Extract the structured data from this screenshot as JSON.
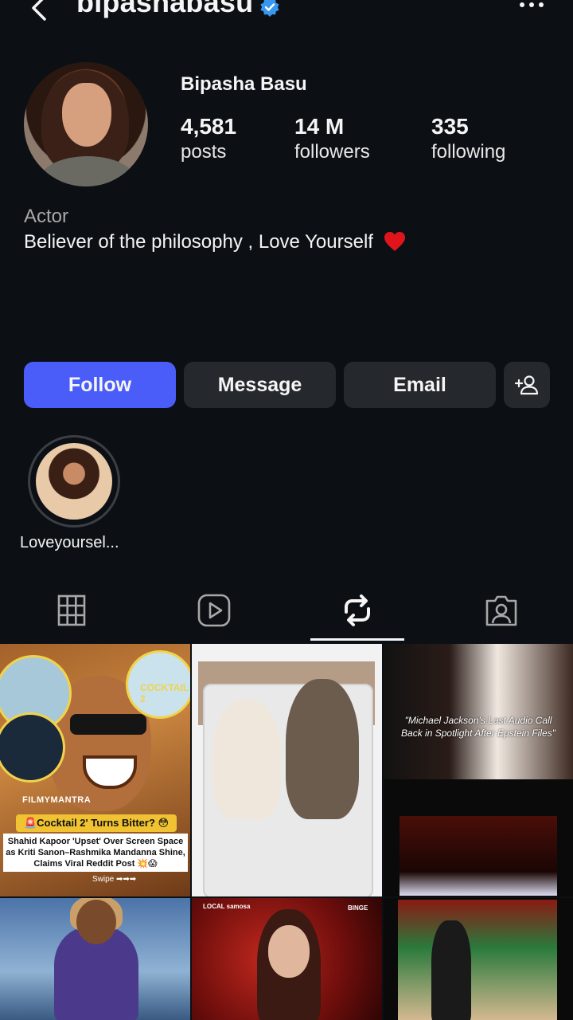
{
  "header": {
    "username": "bipashabasu",
    "verified": true
  },
  "profile": {
    "display_name": "Bipasha Basu",
    "stats": {
      "posts": {
        "value": "4,581",
        "label": "posts"
      },
      "followers": {
        "value": "14 M",
        "label": "followers"
      },
      "following": {
        "value": "335",
        "label": "following"
      }
    },
    "category": "Actor",
    "bio": "Believer of the philosophy , Love Yourself"
  },
  "buttons": {
    "follow": "Follow",
    "message": "Message",
    "email": "Email"
  },
  "highlights": [
    {
      "label": "Loveyoursel..."
    }
  ],
  "tabs": [
    {
      "icon": "grid-icon",
      "active": false
    },
    {
      "icon": "reels-icon",
      "active": false
    },
    {
      "icon": "reposts-icon",
      "active": true
    },
    {
      "icon": "tagged-icon",
      "active": false
    }
  ],
  "grid": {
    "tile1": {
      "cocktail": "COCKTAIL 2",
      "brand": "FILMYMANTRA",
      "headline": "🚨Cocktail 2' Turns Bitter? 😳",
      "sub": "Shahid Kapoor 'Upset' Over Screen Space as Kriti Sanon–Rashmika Mandanna Shine, Claims Viral Reddit Post 💥😱",
      "swipe": "Swipe ➡➡➡"
    },
    "tile3": {
      "caption": "\"Michael Jackson's Last Audio Call Back in Spotlight After Epstein Files\""
    },
    "tile5": {
      "local": "LOCAL samosa",
      "binge": "BINGE"
    }
  },
  "colors": {
    "background": "#0c1014",
    "follow_button": "#4a5df9",
    "secondary_button": "#25292e",
    "verified_badge": "#3897f0",
    "heart": "#e0151b"
  }
}
